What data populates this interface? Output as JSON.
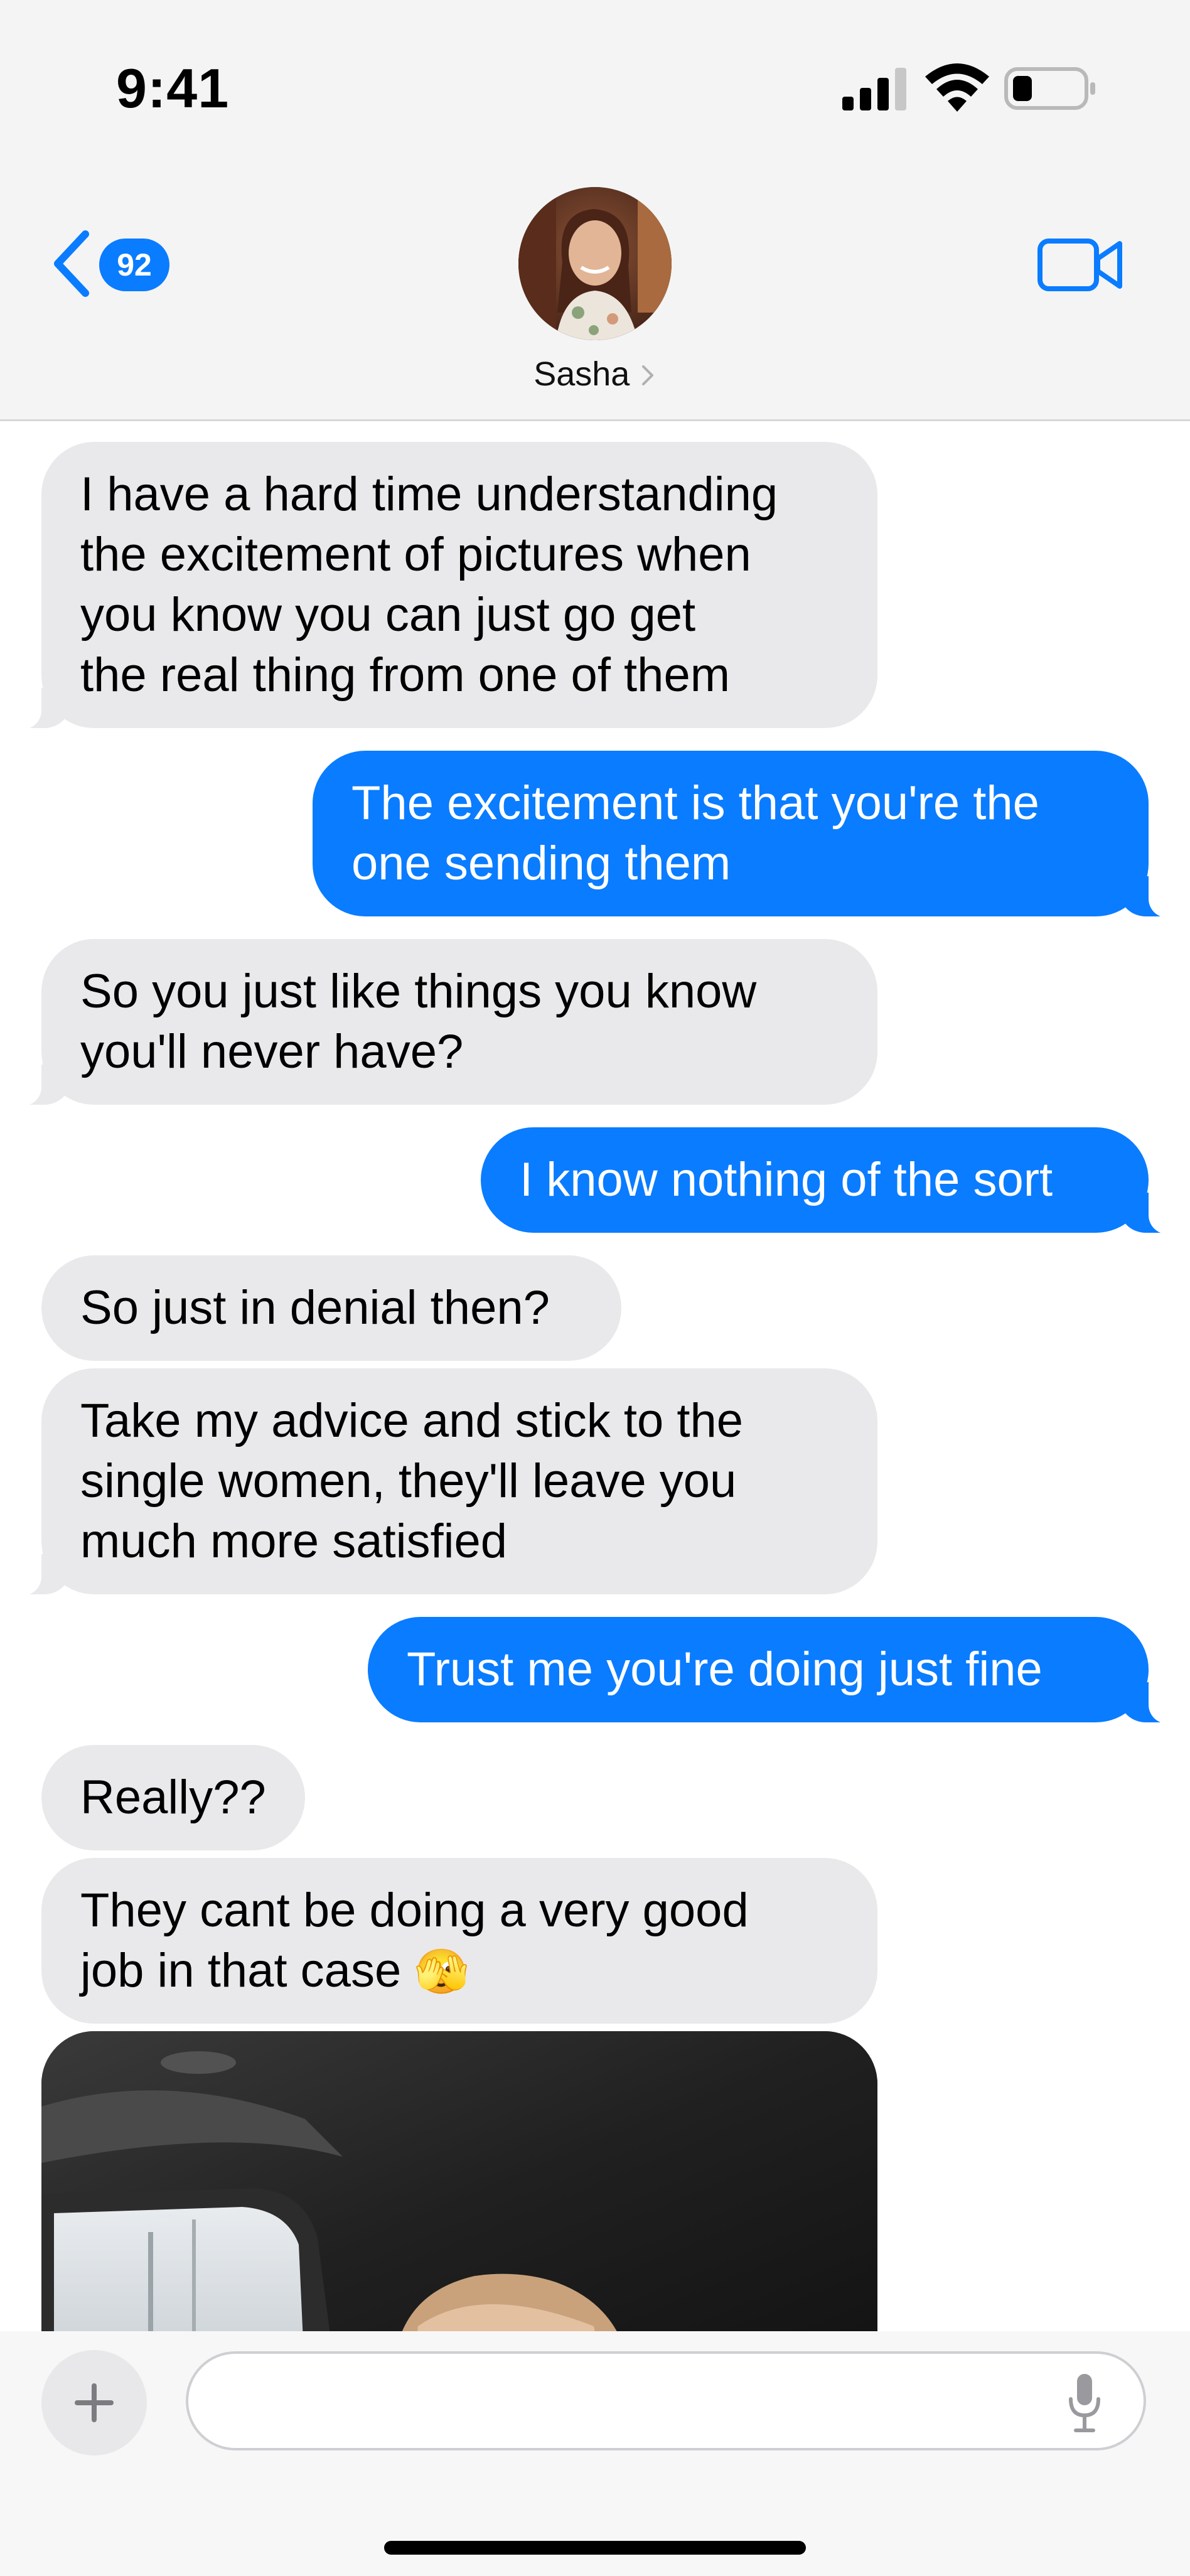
{
  "status_bar": {
    "time": "9:41"
  },
  "header": {
    "back_badge_count": "92",
    "contact_name": "Sasha"
  },
  "messages": [
    {
      "side": "incoming",
      "lines": [
        "I have a hard time understanding",
        "the excitement of pictures when",
        "you know you can just go get",
        "the real thing from one of them"
      ]
    },
    {
      "side": "outgoing",
      "lines": [
        "The excitement is that you're the",
        "one sending them"
      ]
    },
    {
      "side": "incoming",
      "lines": [
        "So you just like things you know",
        "you'll never have?"
      ]
    },
    {
      "side": "outgoing",
      "lines": [
        "I know nothing of the sort"
      ]
    },
    {
      "side": "incoming",
      "lines": [
        "So just in denial then?"
      ]
    },
    {
      "side": "incoming",
      "lines": [
        "Take my advice and stick to the",
        "single women, they'll leave you",
        "much more satisfied"
      ]
    },
    {
      "side": "outgoing",
      "lines": [
        "Trust me you're doing just fine"
      ]
    },
    {
      "side": "incoming",
      "lines": [
        "Really??"
      ]
    },
    {
      "side": "incoming",
      "lines": [
        "They cant be doing a very good",
        "job in that case"
      ],
      "emoji": "🫣"
    },
    {
      "side": "incoming",
      "type": "photo"
    }
  ],
  "colors": {
    "accent": "#0a7cff",
    "incoming_bubble": "#e9e9eb",
    "header_bg": "#f4f4f4"
  },
  "icons": [
    "back-chevron-icon",
    "video-camera-icon",
    "plus-icon",
    "microphone-icon",
    "signal-icon",
    "wifi-icon",
    "battery-icon"
  ]
}
